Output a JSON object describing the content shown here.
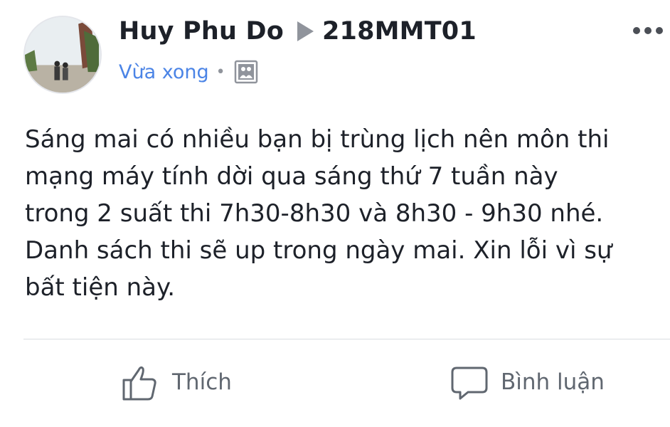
{
  "post": {
    "author": "Huy Phu Do",
    "group": "218MMT01",
    "timestamp": "Vừa xong",
    "audience_icon": "group-audience-icon",
    "more_icon": "more-dots-icon",
    "text_lines": [
      "Sáng mai có nhiều bạn bị trùng lịch nên môn thi",
      "mạng máy tính dời qua sáng thứ 7 tuần này",
      "trong 2 suất thi 7h30-8h30 và 8h30 - 9h30 nhé.",
      "Danh sách thi sẽ up trong ngày mai. Xin lỗi vì sự",
      "bất tiện này."
    ]
  },
  "actions": {
    "like_label": "Thích",
    "comment_label": "Bình luận"
  },
  "colors": {
    "link_blue": "#4b84e6",
    "text": "#1d2129",
    "muted": "#606770"
  }
}
